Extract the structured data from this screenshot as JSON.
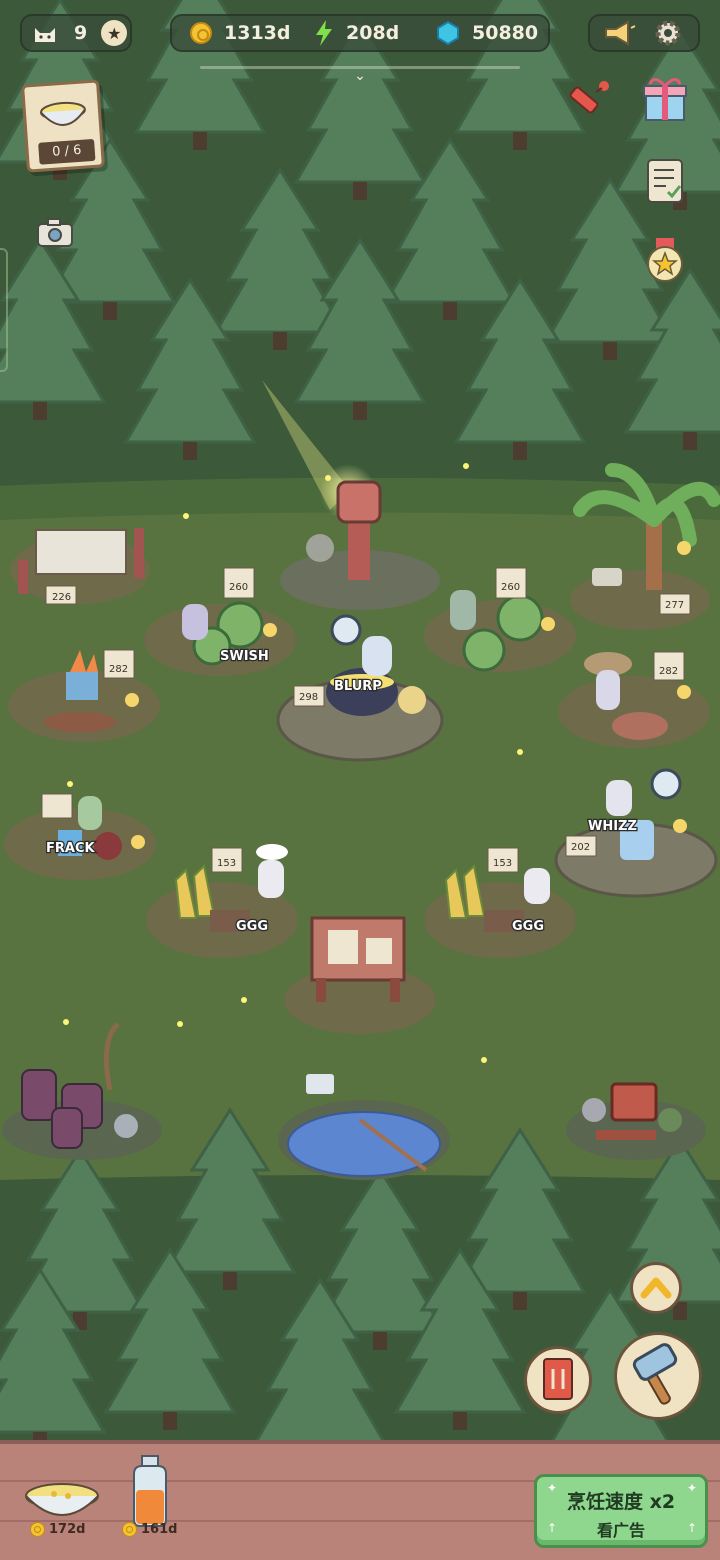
{
  "hud": {
    "cats": "9",
    "coins": "1313d",
    "energy": "208d",
    "gems": "50880"
  },
  "recipe_card": {
    "count": "0 / 6"
  },
  "stations": [
    {
      "name": "laundry",
      "level": "226"
    },
    {
      "name": "watermelon-left",
      "level": "260",
      "sfx": "SWISH"
    },
    {
      "name": "watermelon-right",
      "level": "260"
    },
    {
      "name": "palm-tree",
      "level": "277"
    },
    {
      "name": "carrot-chopping",
      "level": "282"
    },
    {
      "name": "cauldron",
      "level": "298",
      "sfx": "BLURP"
    },
    {
      "name": "mushroom-table",
      "level": "282"
    },
    {
      "name": "frying",
      "level": "",
      "sfx": "FRACK"
    },
    {
      "name": "mixer",
      "level": "202",
      "sfx": "WHIZZ"
    },
    {
      "name": "corn-left",
      "level": "153",
      "sfx": "GGG"
    },
    {
      "name": "corn-right",
      "level": "153",
      "sfx": "GGG"
    }
  ],
  "inventory": [
    {
      "name": "corn-soup",
      "price": "172d"
    },
    {
      "name": "juice-jar",
      "price": "161d"
    }
  ],
  "speed_boost": {
    "title": "烹饪速度 x2",
    "subtitle": "看广告"
  },
  "colors": {
    "grass": "#58733f",
    "forest": "#3c5a3a",
    "tree": "#557f5b",
    "button_green": "#8fd68e",
    "bar_wood": "#b9837a"
  }
}
